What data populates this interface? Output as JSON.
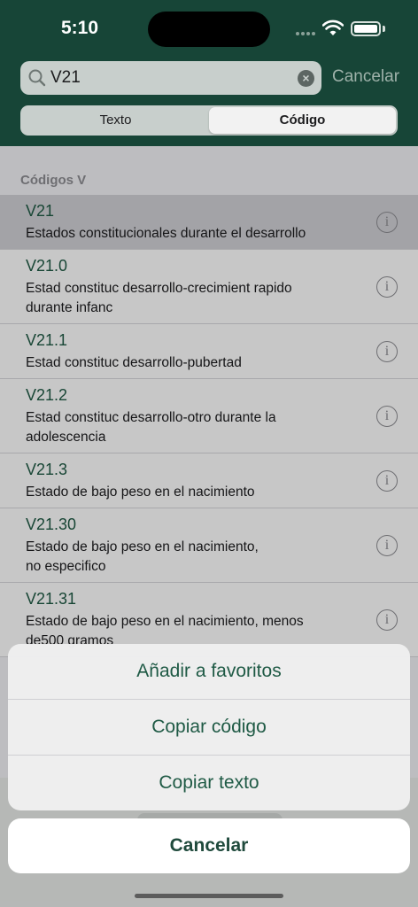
{
  "status": {
    "time": "5:10"
  },
  "search": {
    "value": "V21",
    "cancel_label": "Cancelar"
  },
  "segments": [
    {
      "label": "Texto",
      "active": false
    },
    {
      "label": "Código",
      "active": true
    }
  ],
  "section": {
    "title": "Códigos V"
  },
  "rows": [
    {
      "code": "V21",
      "lines": [
        "Estados constitucionales durante el desarrollo"
      ],
      "selected": true
    },
    {
      "code": "V21.0",
      "lines": [
        "Estad constituc desarrollo-crecimient rapido",
        "durante infanc"
      ],
      "selected": false
    },
    {
      "code": "V21.1",
      "lines": [
        "Estad constituc desarrollo-pubertad"
      ],
      "selected": false
    },
    {
      "code": "V21.2",
      "lines": [
        "Estad constituc desarrollo-otro durante la",
        "adolescencia"
      ],
      "selected": false
    },
    {
      "code": "V21.3",
      "lines": [
        "Estado de bajo peso en el nacimiento"
      ],
      "selected": false
    },
    {
      "code": "V21.30",
      "lines": [
        "Estado de bajo peso en el nacimiento,",
        "no especifico"
      ],
      "selected": false
    },
    {
      "code": "V21.31",
      "lines": [
        "Estado de bajo peso en el nacimiento, menos",
        "de500 gramos"
      ],
      "selected": false
    }
  ],
  "action_sheet": {
    "actions": [
      "Añadir a favoritos",
      "Copiar código",
      "Copiar texto"
    ],
    "cancel_label": "Cancelar"
  },
  "colors": {
    "header": "#174537",
    "accent": "#1f5a45"
  }
}
